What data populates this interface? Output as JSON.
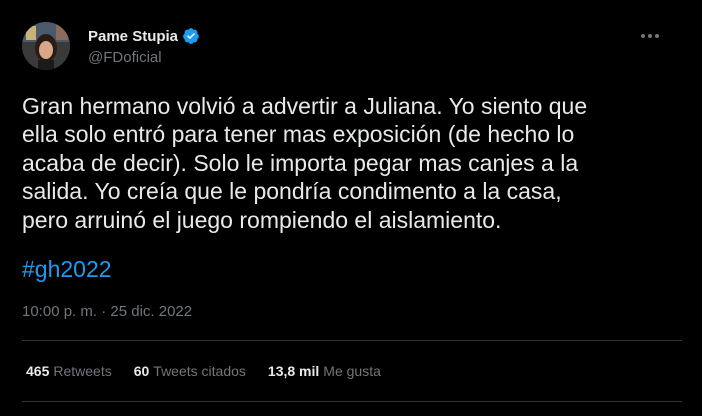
{
  "author": {
    "display_name": "Pame Stupia",
    "handle": "@FDoficial",
    "verified_icon": "verified-badge-icon",
    "avatar_icon": "avatar"
  },
  "tweet": {
    "text": "Gran hermano volvió a advertir a Juliana. Yo siento que\nella solo entró para tener mas exposición (de hecho lo\nacaba de decir). Solo le importa pegar mas canjes a la\nsalida. Yo creía que le pondría condimento a la casa,\npero arruinó el juego rompiendo el aislamiento.",
    "hashtag": "#gh2022",
    "timestamp": "10:00 p. m. · 25 dic. 2022"
  },
  "stats": {
    "retweets_count": "465",
    "retweets_label": "Retweets",
    "quotes_count": "60",
    "quotes_label": "Tweets citados",
    "likes_count": "13,8 mil",
    "likes_label": "Me gusta"
  },
  "colors": {
    "background": "#000000",
    "text": "#e7e9ea",
    "secondary": "#71767b",
    "accent": "#1d9bf0",
    "divider": "#2f3336"
  }
}
